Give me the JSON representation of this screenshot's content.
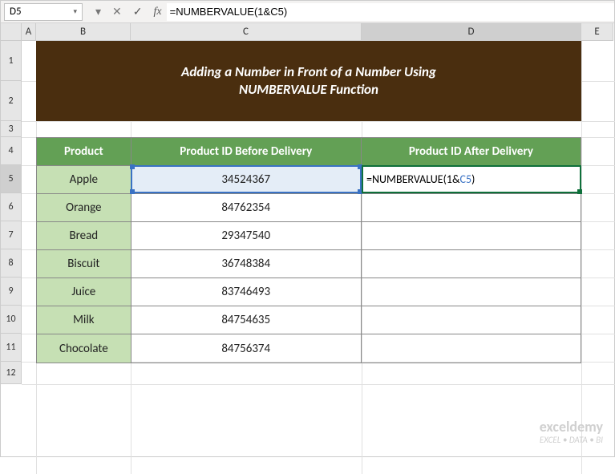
{
  "namebox": {
    "value": "D5"
  },
  "fbar_buttons": {
    "dropdown": "▾",
    "cancel": "✕",
    "confirm": "✓"
  },
  "fx_label": "fx",
  "formula_bar": {
    "value": "=NUMBERVALUE(1&C5)"
  },
  "col_headers": [
    "A",
    "B",
    "C",
    "D",
    "E"
  ],
  "row_headers": [
    "1",
    "2",
    "3",
    "4",
    "5",
    "6",
    "7",
    "8",
    "9",
    "10",
    "11",
    "12"
  ],
  "title": "Adding a Number in Front of a Number Using\nNUMBERVALUE Function",
  "table": {
    "headers": [
      "Product",
      "Product ID Before Delivery",
      "Product ID After Delivery"
    ],
    "rows": [
      {
        "product": "Apple",
        "before": "34524367",
        "after": ""
      },
      {
        "product": "Orange",
        "before": "84762354",
        "after": ""
      },
      {
        "product": "Bread",
        "before": "29347540",
        "after": ""
      },
      {
        "product": "Biscuit",
        "before": "36748384",
        "after": ""
      },
      {
        "product": "Juice",
        "before": "83746493",
        "after": ""
      },
      {
        "product": "Milk",
        "before": "84754635",
        "after": ""
      },
      {
        "product": "Chocolate",
        "before": "84756374",
        "after": ""
      }
    ]
  },
  "editing": {
    "prefix": "=NUMBERVALUE(1&",
    "ref": "C5",
    "suffix": ")"
  },
  "watermark": {
    "brand": "exceldemy",
    "tag": "EXCEL • DATA • BI"
  },
  "layout": {
    "col_widths": {
      "A": 18,
      "B": 118,
      "C": 288,
      "D": 274,
      "E": 40
    },
    "row_heights": {
      "1": 50,
      "2": 50,
      "3": 20,
      "4": 35,
      "5": 35,
      "6": 35,
      "7": 35,
      "8": 35,
      "9": 35,
      "10": 35,
      "11": 35,
      "12": 28
    }
  }
}
